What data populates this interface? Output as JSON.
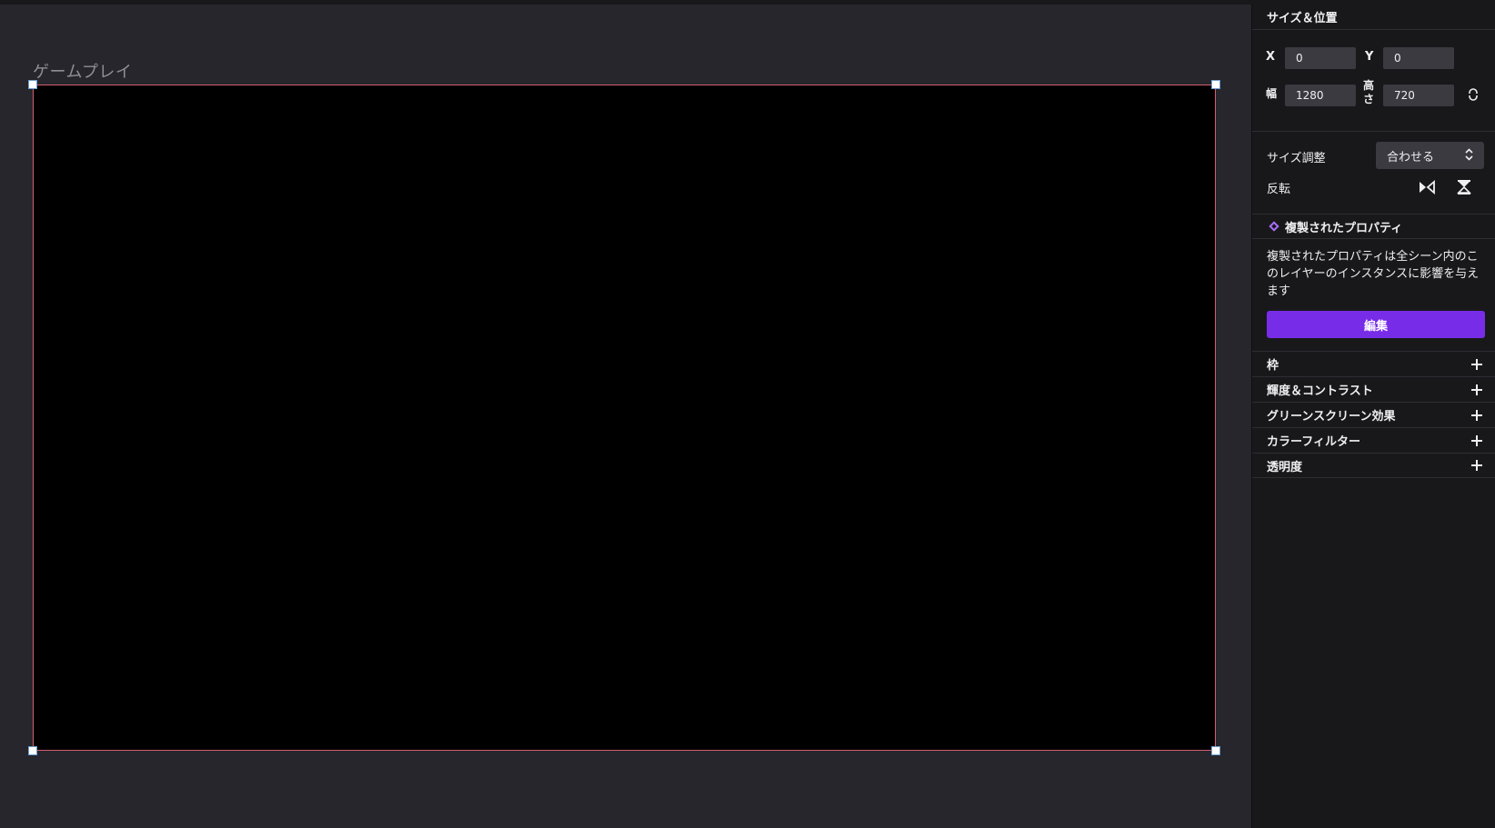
{
  "canvas": {
    "layer_label": "ゲームプレイ"
  },
  "panel": {
    "size_position_title": "サイズ＆位置",
    "x_label": "X",
    "x_value": "0",
    "y_label": "Y",
    "y_value": "0",
    "width_label": "幅",
    "width_value": "1280",
    "height_label": "高さ",
    "height_value": "720",
    "resize_label": "サイズ調整",
    "resize_value": "合わせる",
    "flip_label": "反転",
    "duplicated_title": "複製されたプロパティ",
    "duplicated_desc": "複製されたプロパティは全シーン内のこのレイヤーのインスタンスに影響を与えます",
    "edit_button": "編集",
    "sections": [
      {
        "label": "枠"
      },
      {
        "label": "輝度＆コントラスト"
      },
      {
        "label": "グリーンスクリーン効果"
      },
      {
        "label": "カラーフィルター"
      },
      {
        "label": "透明度"
      }
    ]
  },
  "colors": {
    "accent": "#772ce8",
    "selection_border": "#d45d6e",
    "background": "#26262c",
    "panel": "#18181b"
  }
}
